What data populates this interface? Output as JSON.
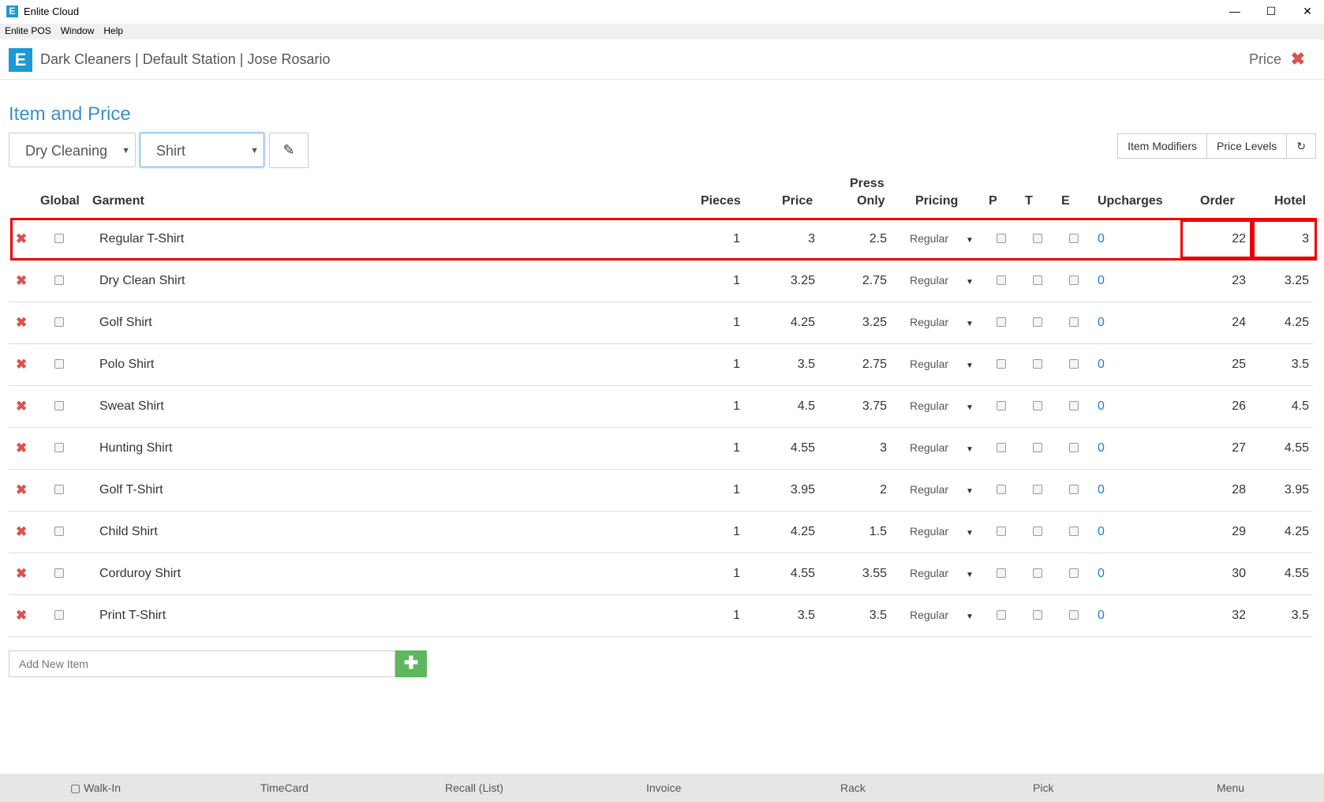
{
  "window": {
    "title": "Enlite Cloud",
    "icon_letter": "E",
    "minimize": "—",
    "maximize": "☐",
    "close": "✕"
  },
  "menubar": [
    "Enlite POS",
    "Window",
    "Help"
  ],
  "header": {
    "station": "Dark Cleaners | Default Station | Jose Rosario",
    "right_label": "Price",
    "close_glyph": "✖",
    "logo_letter": "E"
  },
  "page": {
    "title": "Item and Price"
  },
  "filters": {
    "category": "Dry Cleaning",
    "item": "Shirt",
    "edit_icon": "✎"
  },
  "toolbar": {
    "item_modifiers": "Item Modifiers",
    "price_levels": "Price Levels",
    "refresh_icon": "↻"
  },
  "table": {
    "headers": {
      "global": "Global",
      "garment": "Garment",
      "pieces": "Pieces",
      "price": "Price",
      "press_only_1": "Press",
      "press_only_2": "Only",
      "pricing": "Pricing",
      "p": "P",
      "t": "T",
      "e": "E",
      "upcharges": "Upcharges",
      "order": "Order",
      "hotel": "Hotel"
    },
    "rows": [
      {
        "garment": "Regular T-Shirt",
        "pieces": "1",
        "price": "3",
        "press_only": "2.5",
        "pricing": "Regular",
        "upcharges": "0",
        "order": "22",
        "hotel": "3"
      },
      {
        "garment": "Dry Clean Shirt",
        "pieces": "1",
        "price": "3.25",
        "press_only": "2.75",
        "pricing": "Regular",
        "upcharges": "0",
        "order": "23",
        "hotel": "3.25"
      },
      {
        "garment": "Golf Shirt",
        "pieces": "1",
        "price": "4.25",
        "press_only": "3.25",
        "pricing": "Regular",
        "upcharges": "0",
        "order": "24",
        "hotel": "4.25"
      },
      {
        "garment": "Polo Shirt",
        "pieces": "1",
        "price": "3.5",
        "press_only": "2.75",
        "pricing": "Regular",
        "upcharges": "0",
        "order": "25",
        "hotel": "3.5"
      },
      {
        "garment": "Sweat Shirt",
        "pieces": "1",
        "price": "4.5",
        "press_only": "3.75",
        "pricing": "Regular",
        "upcharges": "0",
        "order": "26",
        "hotel": "4.5"
      },
      {
        "garment": "Hunting Shirt",
        "pieces": "1",
        "price": "4.55",
        "press_only": "3",
        "pricing": "Regular",
        "upcharges": "0",
        "order": "27",
        "hotel": "4.55"
      },
      {
        "garment": "Golf T-Shirt",
        "pieces": "1",
        "price": "3.95",
        "press_only": "2",
        "pricing": "Regular",
        "upcharges": "0",
        "order": "28",
        "hotel": "3.95"
      },
      {
        "garment": "Child Shirt",
        "pieces": "1",
        "price": "4.25",
        "press_only": "1.5",
        "pricing": "Regular",
        "upcharges": "0",
        "order": "29",
        "hotel": "4.25"
      },
      {
        "garment": "Corduroy Shirt",
        "pieces": "1",
        "price": "4.55",
        "press_only": "3.55",
        "pricing": "Regular",
        "upcharges": "0",
        "order": "30",
        "hotel": "4.55"
      },
      {
        "garment": "Print T-Shirt",
        "pieces": "1",
        "price": "3.5",
        "press_only": "3.5",
        "pricing": "Regular",
        "upcharges": "0",
        "order": "32",
        "hotel": "3.5"
      }
    ]
  },
  "add_item": {
    "placeholder": "Add New Item",
    "button": "✚"
  },
  "footer": {
    "walk_in": "▢ Walk-In",
    "timecard": "TimeCard",
    "recall": "Recall (List)",
    "invoice": "Invoice",
    "rack": "Rack",
    "pick": "Pick",
    "menu": "Menu"
  }
}
